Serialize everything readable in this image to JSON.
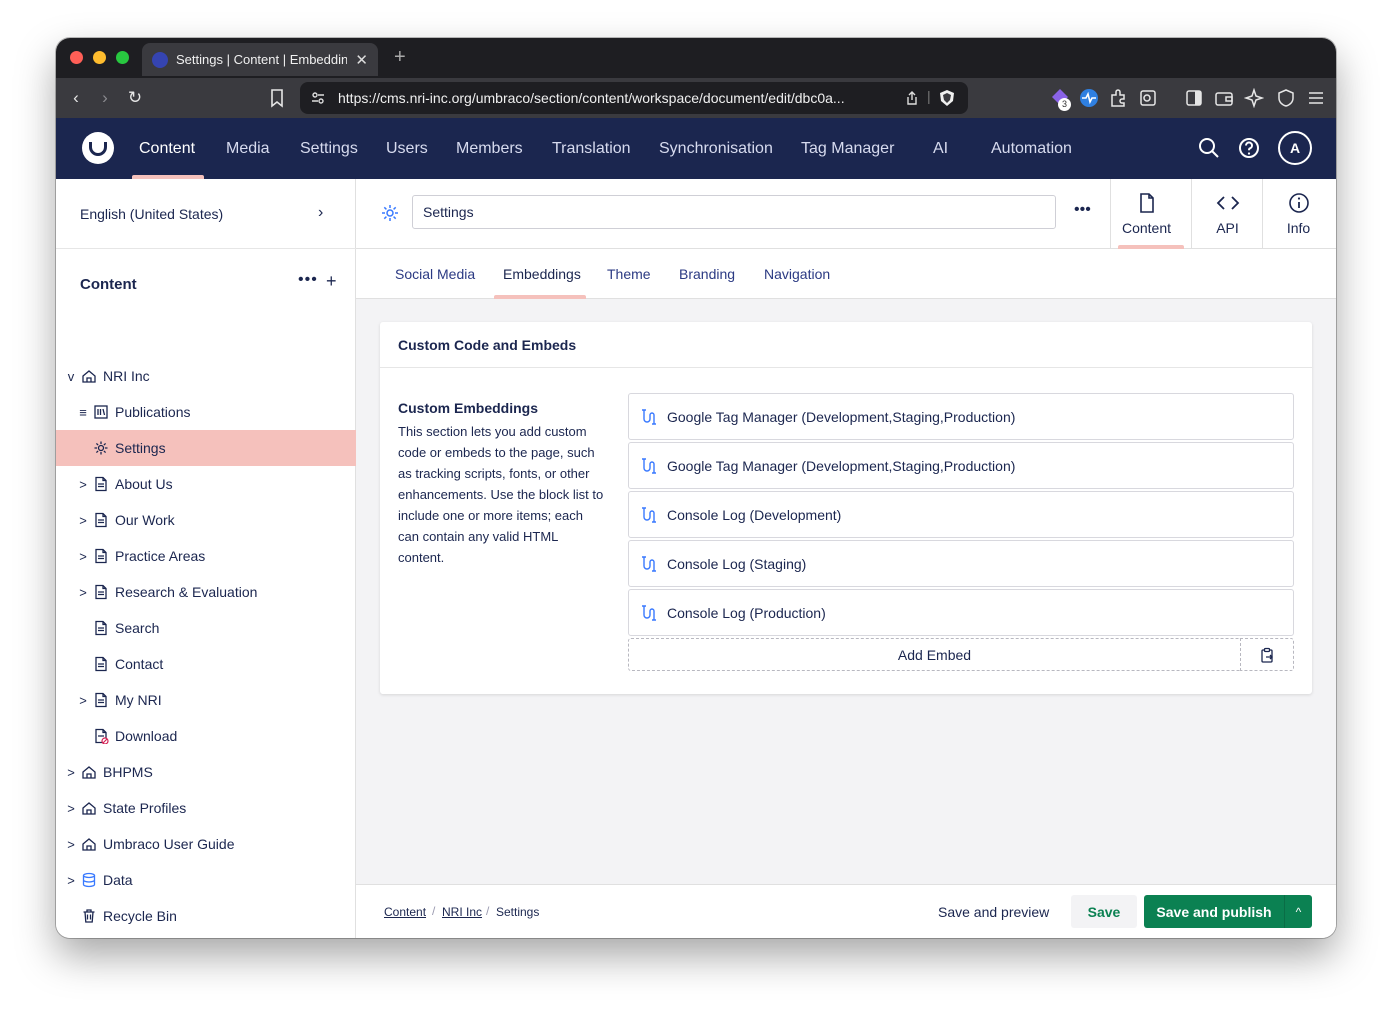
{
  "browser": {
    "tab_title": "Settings | Content | Embeddings",
    "new_tab": "+",
    "close": "✕",
    "url": "https://cms.nri-inc.org/umbraco/section/content/workspace/document/edit/dbc0a...",
    "extension_badge": "3",
    "colors": {
      "close": "#ff5f57",
      "minimize": "#febc2e",
      "zoom": "#28c840"
    }
  },
  "header": {
    "sections": [
      "Content",
      "Media",
      "Settings",
      "Users",
      "Members",
      "Translation",
      "Synchronisation",
      "Tag Manager",
      "AI",
      "Automation"
    ],
    "active_section": "Content",
    "avatar_initial": "A",
    "colors": {
      "bar": "#1b264f",
      "accent": "#f5c1bc"
    }
  },
  "sidebar": {
    "culture": "English (United States)",
    "tree_title": "Content",
    "tree_actions": {
      "more": "•••",
      "create": "+"
    },
    "items": [
      {
        "label": "NRI Inc",
        "icon": "home-icon",
        "expander": "v"
      },
      {
        "label": "Publications",
        "icon": "library-icon",
        "expander": "≡"
      },
      {
        "label": "Settings",
        "icon": "gear-icon",
        "selected": true
      },
      {
        "label": "About Us",
        "icon": "document-icon",
        "expander": ">"
      },
      {
        "label": "Our Work",
        "icon": "document-icon",
        "expander": ">"
      },
      {
        "label": "Practice Areas",
        "icon": "document-icon",
        "expander": ">"
      },
      {
        "label": "Research & Evaluation",
        "icon": "document-icon",
        "expander": ">"
      },
      {
        "label": "Search",
        "icon": "document-icon"
      },
      {
        "label": "Contact",
        "icon": "document-icon"
      },
      {
        "label": "My NRI",
        "icon": "document-icon",
        "expander": ">"
      },
      {
        "label": "Download",
        "icon": "document-unpublished-icon"
      },
      {
        "label": "BHPMS",
        "icon": "home-icon",
        "expander": ">"
      },
      {
        "label": "State Profiles",
        "icon": "home-icon",
        "expander": ">"
      },
      {
        "label": "Umbraco User Guide",
        "icon": "home-icon",
        "expander": ">"
      },
      {
        "label": "Data",
        "icon": "database-icon",
        "expander": ">"
      },
      {
        "label": "Recycle Bin",
        "icon": "trash-icon"
      }
    ]
  },
  "workspace": {
    "name": "Settings",
    "more": "•••",
    "views": [
      {
        "label": "Content",
        "icon": "document-icon",
        "active": true
      },
      {
        "label": "API",
        "icon": "code-icon"
      },
      {
        "label": "Info",
        "icon": "info-icon"
      }
    ],
    "tabs": [
      "Social Media",
      "Embeddings",
      "Theme",
      "Branding",
      "Navigation"
    ],
    "active_tab": "Embeddings",
    "group_title": "Custom Code and Embeds",
    "property": {
      "label": "Custom Embeddings",
      "description": "This section lets you add custom code or embeds to the page, such as tracking scripts, fonts, or other enhancements. Use the block list to include one or more items; each can contain any valid HTML content."
    },
    "blocks": [
      "Google Tag Manager (Development,Staging,Production)",
      "Google Tag Manager (Development,Staging,Production)",
      "Console Log (Development)",
      "Console Log (Staging)",
      "Console Log (Production)"
    ],
    "add_label": "Add Embed"
  },
  "footer": {
    "breadcrumbs": [
      "Content",
      "NRI Inc",
      "Settings"
    ],
    "breadcrumb_sep": "/",
    "save_preview": "Save and preview",
    "save": "Save",
    "save_publish": "Save and publish",
    "publish_arrow": "^",
    "colors": {
      "positive": "#0b8152"
    }
  }
}
